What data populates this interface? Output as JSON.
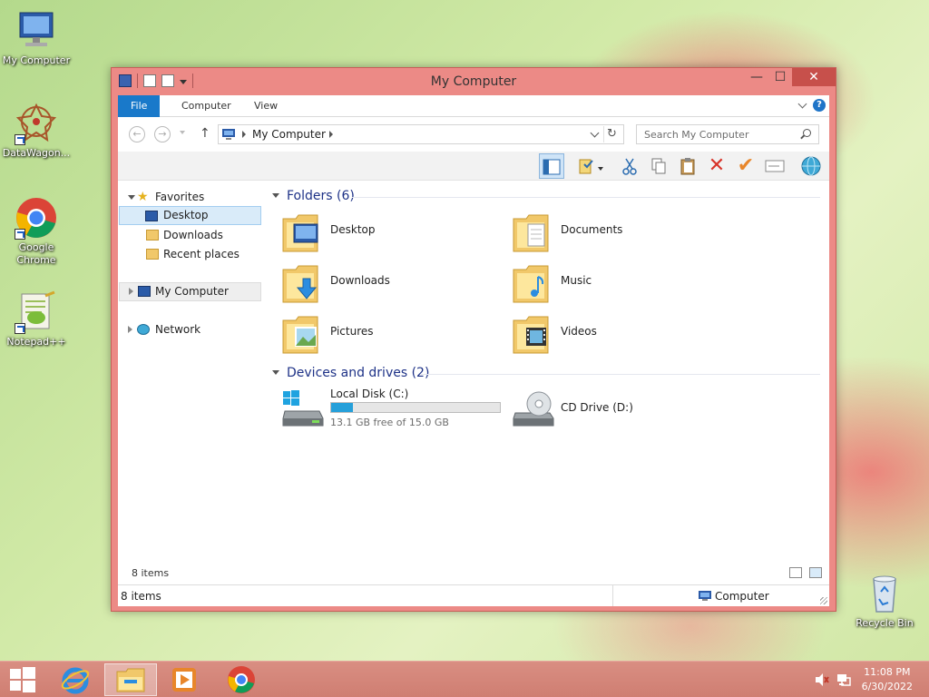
{
  "desktop": {
    "icons": [
      {
        "label": "My Computer"
      },
      {
        "label": "DataWagon..."
      },
      {
        "label": "Google Chrome"
      },
      {
        "label": "Notepad++"
      },
      {
        "label": "Recycle Bin"
      }
    ]
  },
  "window": {
    "title": "My Computer",
    "controls": {
      "minimize": "—",
      "maximize": "☐",
      "close": "✕"
    }
  },
  "ribbon": {
    "tabs": [
      {
        "label": "File"
      },
      {
        "label": "Computer"
      },
      {
        "label": "View"
      }
    ],
    "help": "?"
  },
  "navigation": {
    "back": "←",
    "forward": "→",
    "up": "↑",
    "address": "My Computer",
    "refresh": "↻",
    "search_placeholder": "Search My Computer"
  },
  "toolbar": {
    "tools": [
      "preview-pane-icon",
      "properties-icon",
      "cut-icon",
      "copy-icon",
      "paste-icon",
      "delete-icon",
      "check-icon",
      "rename-icon",
      "globe-icon"
    ]
  },
  "navpane": {
    "favorites": "Favorites",
    "items": [
      {
        "label": "Desktop"
      },
      {
        "label": "Downloads"
      },
      {
        "label": "Recent places"
      }
    ],
    "computer": "My Computer",
    "network": "Network"
  },
  "folders": {
    "header": "Folders (6)",
    "items": [
      {
        "name": "Desktop"
      },
      {
        "name": "Documents"
      },
      {
        "name": "Downloads"
      },
      {
        "name": "Music"
      },
      {
        "name": "Pictures"
      },
      {
        "name": "Videos"
      }
    ]
  },
  "drives": {
    "header": "Devices and drives (2)",
    "items": [
      {
        "name": "Local Disk (C:)",
        "free_text": "13.1 GB free of 15.0 GB",
        "used_fraction": 0.127
      },
      {
        "name": "CD Drive (D:)"
      }
    ]
  },
  "status": {
    "info_count": "8 items",
    "items_count": "8 items",
    "location": "Computer"
  },
  "taskbar": {
    "time": "11:08 PM",
    "date": "6/30/2022"
  },
  "colors": {
    "accent": "#1979ca",
    "window_frame": "#ec8a86",
    "taskbar": "#d98e82",
    "drive_fill": "#26a0da"
  }
}
